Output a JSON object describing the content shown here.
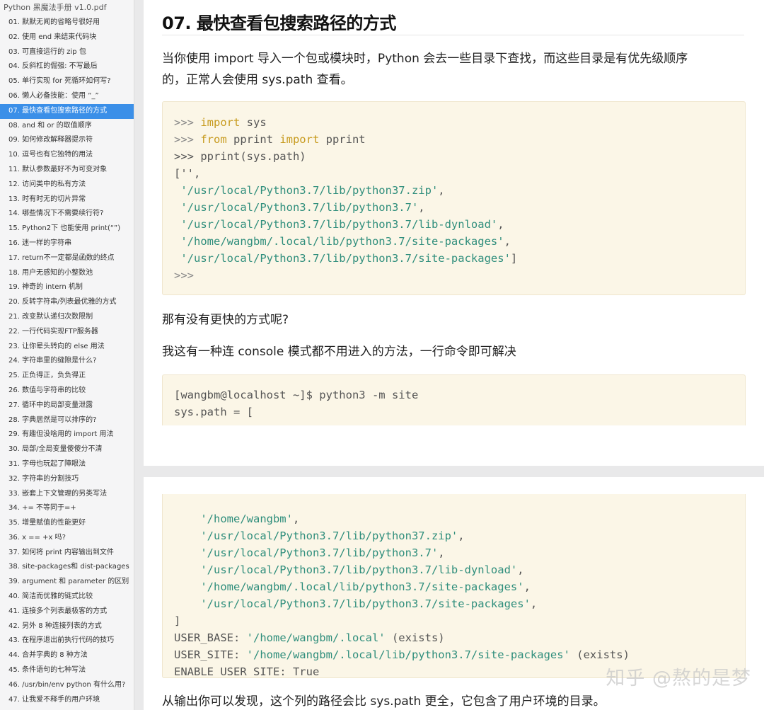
{
  "sidebar": {
    "title": "Python 黑魔法手册 v1.0.pdf",
    "items": [
      "01. 默默无闻的省略号很好用",
      "02. 使用 end 来结束代码块",
      "03. 可直接运行的 zip 包",
      "04. 反斜杠的倔强: 不写最后",
      "05. 单行实现 for 死循环如何写?",
      "06. 懒人必备技能：使用 “_”",
      "07. 最快查看包搜索路径的方式",
      "08. and 和 or 的取值顺序",
      "09. 如何修改解释器提示符",
      "10. 逗号也有它独特的用法",
      "11. 默认参数最好不为可变对象",
      "12. 访问类中的私有方法",
      "13. 时有时无的切片异常",
      "14. 哪些情况下不需要续行符?",
      "15. Python2下 也能使用 print(“”)",
      "16. 迷一样的字符串",
      "17. return不一定都是函数的终点",
      "18. 用户无感知的小整数池",
      "19. 神奇的 intern 机制",
      "20. 反转字符串/列表最优雅的方式",
      "21. 改变默认递归次数限制",
      "22. 一行代码实现FTP服务器",
      "23. 让你晕头转向的 else 用法",
      "24. 字符串里的缝隙是什么?",
      "25. 正负得正，负负得正",
      "26. 数值与字符串的比较",
      "27. 循环中的局部变量泄露",
      "28. 字典居然是可以排序的?",
      "29. 有趣但没啥用的 import 用法",
      "30. 局部/全局变量傻傻分不清",
      "31. 字母也玩起了障眼法",
      "32. 字符串的分割技巧",
      "33. 嵌套上下文管理的另类写法",
      "34. += 不等同于=+",
      "35. 增量赋值的性能更好",
      "36. x == +x 吗?",
      "37.  如何将 print 内容输出到文件",
      "38. site-packages和 dist-packages",
      "39. argument 和 parameter 的区别",
      "40.  简洁而优雅的链式比较",
      "41. 连接多个列表最极客的方式",
      "42. 另外 8 种连接列表的方式",
      "43. 在程序退出前执行代码的技巧",
      "44. 合并字典的 8 种方法",
      "45. 条件语句的七种写法",
      "46. /usr/bin/env python 有什么用?",
      "47. 让我爱不释手的用户环境"
    ],
    "active_index": 6,
    "colors": {
      "active_bg": "#3b8fe8"
    }
  },
  "page1": {
    "heading": "07. 最快查看包搜索路径的方式",
    "para1_line1": "当你使用 import 导入一个包或模块时，Python 会去一些目录下查找，而这些目录是有优先级顺序",
    "para1_line2": "的，正常人会使用 sys.path 查看。",
    "code1": {
      "l1_prompt": ">>> ",
      "l1_kw": "import",
      "l1_rest": " sys",
      "l2_prompt": ">>> ",
      "l2_kw1": "from",
      "l2_mid": " pprint ",
      "l2_kw2": "import",
      "l2_rest": " pprint",
      "l3": ">>> pprint(sys.path)",
      "l4": "['',",
      "l5": " '/usr/local/Python3.7/lib/python37.zip'",
      "l6": " '/usr/local/Python3.7/lib/python3.7'",
      "l7": " '/usr/local/Python3.7/lib/python3.7/lib-dynload'",
      "l8": " '/home/wangbm/.local/lib/python3.7/site-packages'",
      "l9": " '/usr/local/Python3.7/lib/python3.7/site-packages'",
      "l10": ">>>",
      "comma": ",",
      "close": "]"
    },
    "para2": "那有没有更快的方式呢?",
    "para3": "我这有一种连 console 模式都不用进入的方法，一行命令即可解决",
    "code2": {
      "l1": "[wangbm@localhost ~]$ python3 -m site",
      "l2": "sys.path = ["
    }
  },
  "page2": {
    "code3": {
      "l1": "    '/home/wangbm'",
      "l2": "    '/usr/local/Python3.7/lib/python37.zip'",
      "l3": "    '/usr/local/Python3.7/lib/python3.7'",
      "l4": "    '/usr/local/Python3.7/lib/python3.7/lib-dynload'",
      "l5": "    '/home/wangbm/.local/lib/python3.7/site-packages'",
      "l6": "    '/usr/local/Python3.7/lib/python3.7/site-packages'",
      "l7": "]",
      "l8_key": "USER_BASE: ",
      "l8_val": "'/home/wangbm/.local'",
      "l8_rest": " (exists)",
      "l9_key": "USER_SITE: ",
      "l9_val": "'/home/wangbm/.local/lib/python3.7/site-packages'",
      "l9_rest": " (exists)",
      "l10": "ENABLE_USER_SITE: True",
      "comma": ","
    },
    "para": "从输出你可以发现，这个列的路径会比 sys.path 更全，它包含了用户环境的目录。",
    "watermark": "知乎 @熬的是梦"
  }
}
